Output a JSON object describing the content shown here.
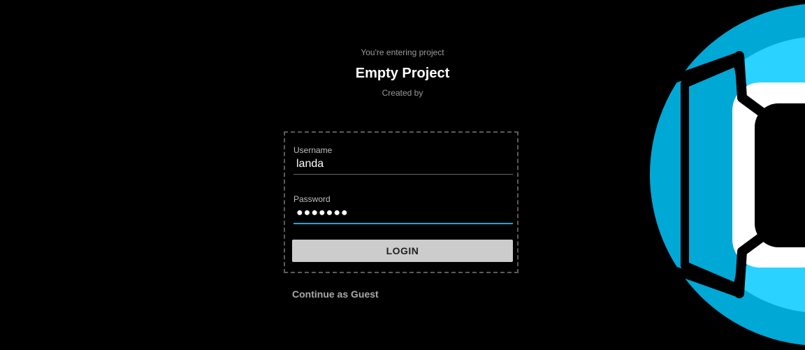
{
  "header": {
    "subtitle": "You're entering project",
    "project_title": "Empty Project",
    "created_by": "Created by"
  },
  "login_form": {
    "username_label": "Username",
    "username_value": "landa",
    "password_label": "Password",
    "password_value": "●●●●●●●",
    "login_label": "LOGIN"
  },
  "guest_link": "Continue as Guest",
  "logo": {
    "icon": "app-logo-icon",
    "colors": {
      "outer": "#00a8d6",
      "inner": "#29d2ff",
      "accent": "#ffffff",
      "background": "#000000"
    }
  },
  "colors": {
    "focus_underline": "#1aa7d6",
    "button_bg": "#cccccc"
  }
}
